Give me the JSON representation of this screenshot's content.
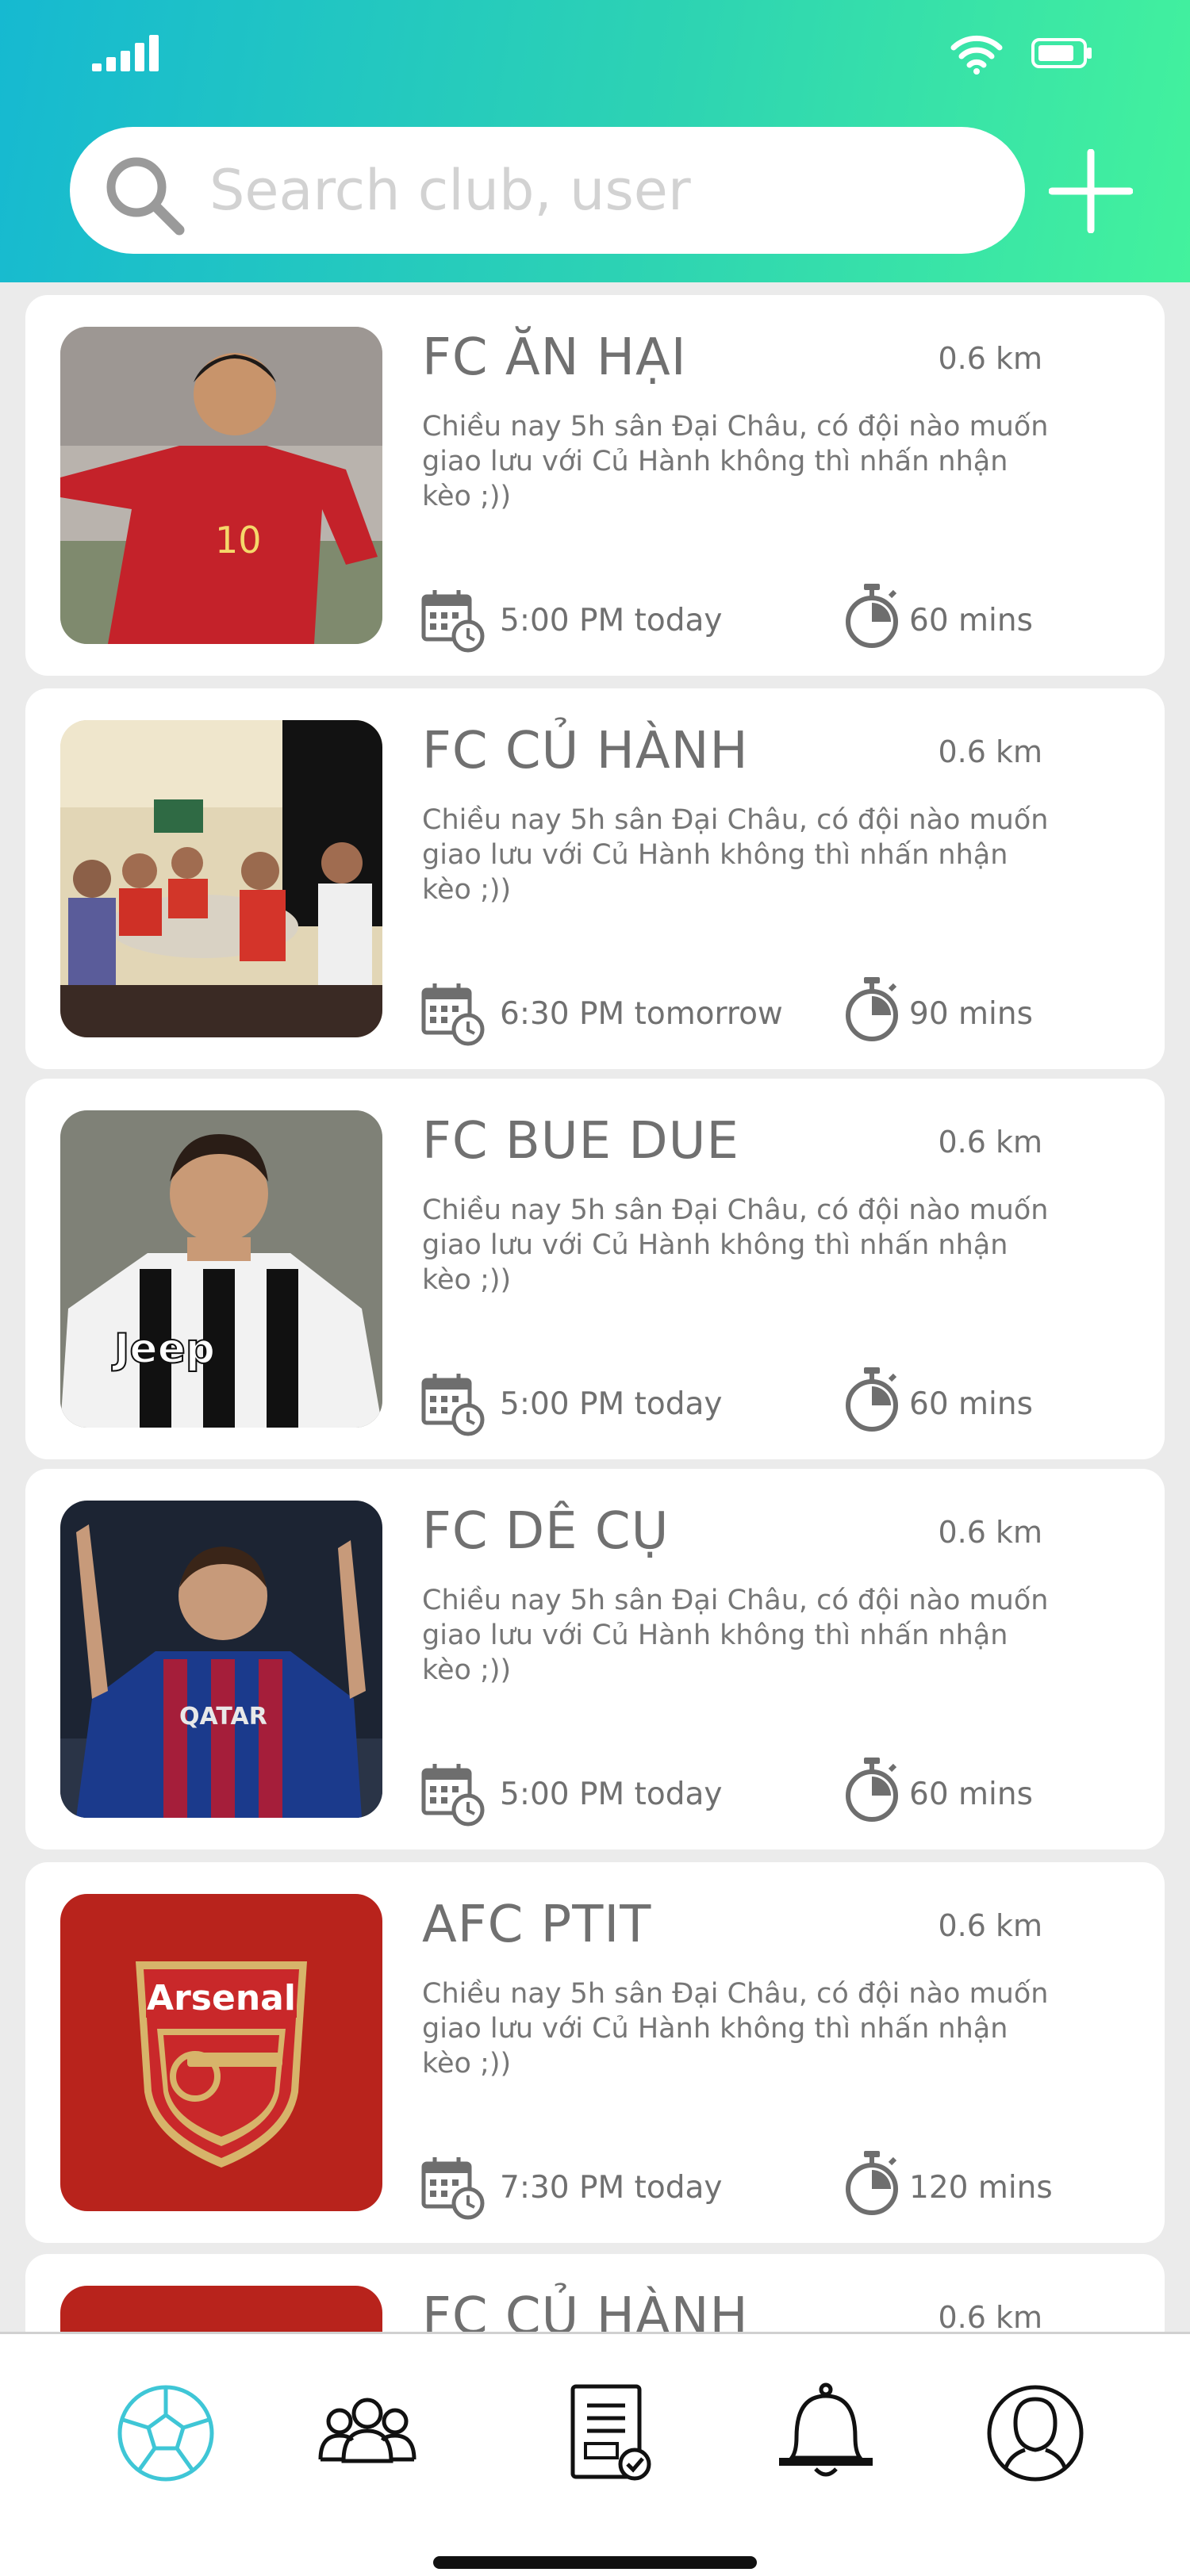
{
  "status_bar": {
    "icons": [
      "signal-icon",
      "wifi-icon",
      "battery-icon"
    ]
  },
  "search": {
    "placeholder": "Search club, user",
    "value": ""
  },
  "header_actions": {
    "add_icon": "plus-icon"
  },
  "clubs": [
    {
      "name": "FC ĂN HẠI",
      "distance": "0.6 km",
      "description": "Chiều nay 5h sân Đại Châu, có đội nào muốn giao lưu với Củ Hành không thì nhấn nhận kèo ;))",
      "time": "5:00 PM today",
      "duration": "60 mins"
    },
    {
      "name": "FC CỦ HÀNH",
      "distance": "0.6 km",
      "description": "Chiều nay 5h sân Đại Châu, có đội nào muốn giao lưu với Củ Hành không thì nhấn nhận kèo ;))",
      "time": "6:30 PM tomorrow",
      "duration": "90 mins"
    },
    {
      "name": "FC BUE DUE",
      "distance": "0.6 km",
      "description": "Chiều nay 5h sân Đại Châu, có đội nào muốn giao lưu với Củ Hành không thì nhấn nhận kèo ;))",
      "time": "5:00 PM today",
      "duration": "60 mins"
    },
    {
      "name": "FC DÊ CỤ",
      "distance": "0.6 km",
      "description": "Chiều nay 5h sân Đại Châu, có đội nào muốn giao lưu với Củ Hành không thì nhấn nhận kèo ;))",
      "time": "5:00 PM today",
      "duration": "60 mins"
    },
    {
      "name": "AFC PTIT",
      "distance": "0.6 km",
      "description": "Chiều nay 5h sân Đại Châu, có đội nào muốn giao lưu với Củ Hành không thì nhấn nhận kèo ;))",
      "time": "7:30 PM today",
      "duration": "120 mins",
      "logo_text": "Arsenal"
    },
    {
      "name": "FC CỦ HÀNH",
      "distance": "0.6 km",
      "description": "",
      "time": "",
      "duration": ""
    }
  ],
  "bottom_nav": {
    "items": [
      "soccer-ball-icon",
      "group-icon",
      "document-check-icon",
      "bell-icon",
      "profile-icon"
    ],
    "active": "soccer-ball-icon"
  },
  "colors": {
    "header_gradient_start": "#16b9d1",
    "header_gradient_end": "#43f29d",
    "active_nav": "#3fc6d6",
    "card_background": "#ffffff",
    "page_background": "#ebebeb"
  }
}
